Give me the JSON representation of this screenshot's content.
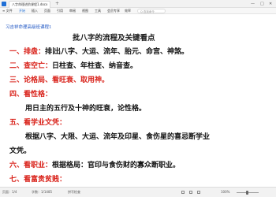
{
  "window": {
    "tab_title": "八字命理进阶课程1.docx",
    "add_tab": "+",
    "minimize": "—",
    "maximize": "□",
    "close": "✕"
  },
  "menubar": {
    "file": "≡ 文件",
    "items": [
      "开始",
      "插入",
      "页面",
      "引用",
      "审阅",
      "视图",
      "工具",
      "会员专享",
      "效率"
    ],
    "active_index": 0,
    "search_placeholder": "Q 查找命令",
    "accent_color": "#1f6fd6"
  },
  "document": {
    "header": "习吉祥命理高级班课程1",
    "title": "批八字的流程及关键看点",
    "lines": [
      {
        "red": "一、排盘：",
        "black_before_cursor": "排",
        "black": "出八字、大运、流年、胎元、命宫、神煞。"
      },
      {
        "red": "二、查空亡：",
        "black": "日柱查、年柱查、纳音查。"
      },
      {
        "red": "三、论格局、看旺衰、取用神。",
        "black": ""
      },
      {
        "red": "四、看性格：",
        "black": ""
      },
      {
        "red": "",
        "black": "用日主的五行及十神的旺衰，论性格。"
      },
      {
        "red": "五、看学业文凭：",
        "black": ""
      },
      {
        "red": "",
        "black": "根据八字、大限、大运、流年及印星、食伤星的喜忌断学业"
      },
      {
        "red": "",
        "black": "文凭。"
      },
      {
        "red": "六、看职业：",
        "black": "根据格局：官印与食伤财的寡众断职业。"
      },
      {
        "red": "七、看富贵贫贱：",
        "black": ""
      }
    ],
    "heading_color": "#d9221a",
    "header_color": "#1f56c4"
  },
  "statusbar": {
    "page": "页面：1/4",
    "words": "字数：1/1485",
    "spell": "拼写检查",
    "zoom": "100%"
  }
}
